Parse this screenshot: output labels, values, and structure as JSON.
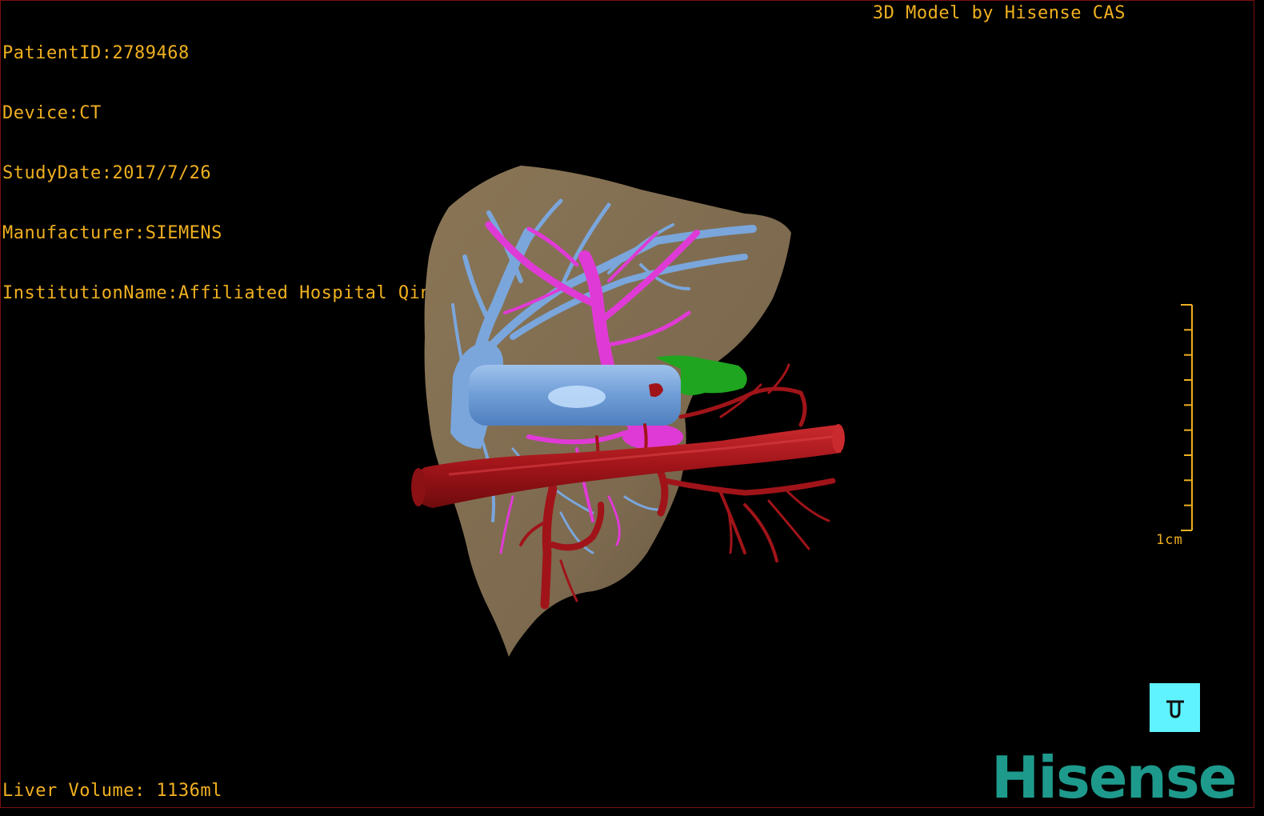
{
  "patient_info": [
    {
      "label": "PatientID",
      "value": "2789468"
    },
    {
      "label": "Device",
      "value": "CT"
    },
    {
      "label": "StudyDate",
      "value": "2017/7/26"
    },
    {
      "label": "Manufacturer",
      "value": "SIEMENS"
    },
    {
      "label": "InstitutionName",
      "value": "Affiliated Hospital Qingdao University-C"
    }
  ],
  "watermark": "3D Model by Hisense CAS",
  "volume_text": "Liver Volume: 1136ml",
  "scale_bar": {
    "label": "1cm",
    "tick_count": 10
  },
  "view_button": {
    "icon": "orientation-icon"
  },
  "logo_text": "Hisense",
  "colors": {
    "overlay_text": "#f0b020",
    "liver": "#7d6a4f",
    "hepatic_vein": "#7aa6dc",
    "portal_vein": "#e03ad6",
    "artery": "#a01419",
    "gallbladder": "#1fa51f",
    "view_button": "#5ff3ff",
    "logo": "#1e9a8c"
  }
}
